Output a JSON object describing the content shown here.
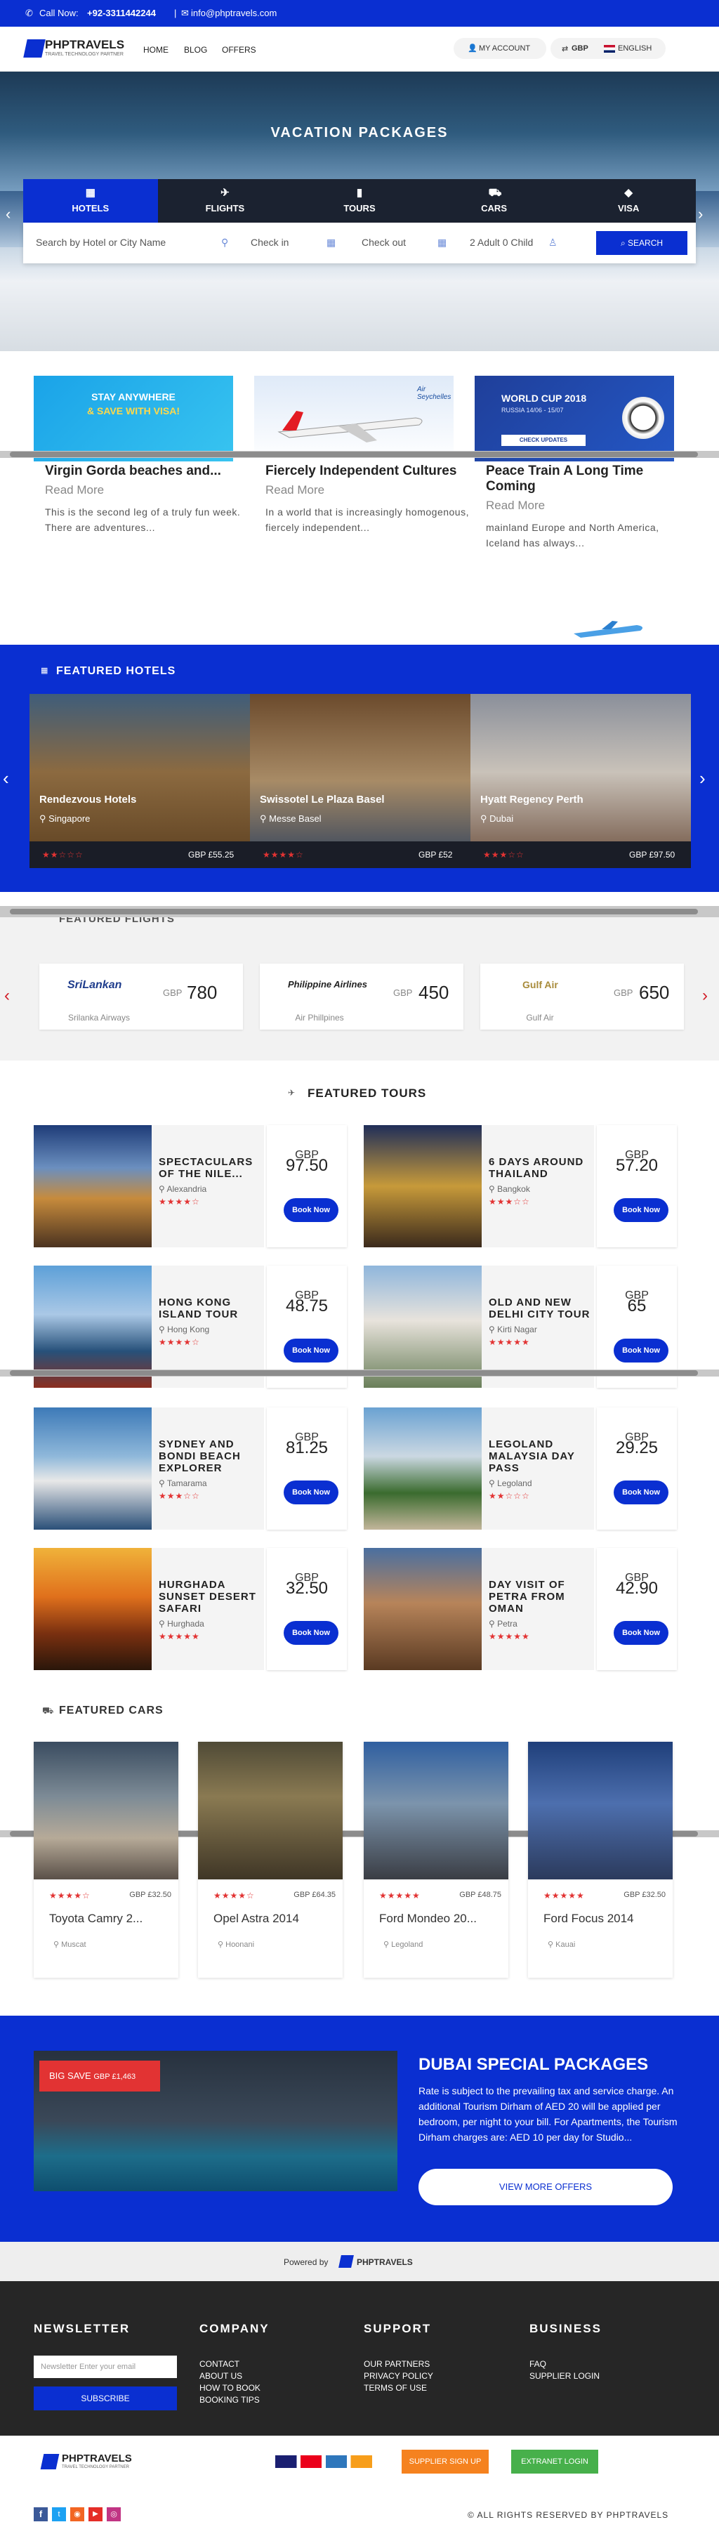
{
  "topbar": {
    "phone_label": "Call Now:",
    "phone": "+92-3311442244",
    "email": "info@phptravels.com"
  },
  "brand": {
    "name": "PHPTRAVELS",
    "tagline": "TRAVEL TECHNOLOGY PARTNER"
  },
  "nav": {
    "items": [
      "HOME",
      "BLOG",
      "OFFERS"
    ],
    "account": "MY ACCOUNT",
    "currency": "GBP",
    "language": "ENGLISH"
  },
  "hero": {
    "title": "VACATION PACKAGES",
    "tabs": [
      {
        "label": "HOTELS",
        "icon": "building-icon"
      },
      {
        "label": "FLIGHTS",
        "icon": "plane-icon"
      },
      {
        "label": "TOURS",
        "icon": "briefcase-icon"
      },
      {
        "label": "CARS",
        "icon": "car-icon"
      },
      {
        "label": "VISA",
        "icon": "tag-icon"
      }
    ],
    "search": {
      "placeholder": "Search by Hotel or City Name",
      "checkin": "Check in",
      "checkout": "Check out",
      "guests": "2 Adult 0 Child",
      "button": "SEARCH"
    }
  },
  "banners": [
    {
      "line1": "STAY ANYWHERE",
      "line2": "& SAVE WITH VISA!"
    },
    {
      "brand": "Air Seychelles"
    },
    {
      "title": "WORLD CUP 2018",
      "sub": "RUSSIA 14/06 - 15/07",
      "cta": "CHECK UPDATES"
    }
  ],
  "posts": [
    {
      "title": "Virgin Gorda beaches and...",
      "more": "Read More",
      "excerpt": "This is the second leg of a truly fun week. There are adventures..."
    },
    {
      "title": "Fiercely Independent Cultures",
      "more": "Read More",
      "excerpt": "In a world that is increasingly homogenous, fiercely independent..."
    },
    {
      "title": "Peace Train A Long Time Coming",
      "more": "Read More",
      "excerpt": " mainland Europe and North America, Iceland has always..."
    }
  ],
  "featured_hotels": {
    "title": "FEATURED HOTELS",
    "items": [
      {
        "name": "Rendezvous Hotels",
        "location": "Singapore",
        "stars": 2,
        "price": "GBP £55.25"
      },
      {
        "name": "Swissotel Le Plaza Basel",
        "location": "Messe Basel",
        "stars": 4,
        "price": "GBP £52"
      },
      {
        "name": "Hyatt Regency Perth",
        "location": "Dubai",
        "stars": 3,
        "price": "GBP £97.50"
      }
    ]
  },
  "featured_flights": {
    "title": "FEATURED FLIGHTS",
    "items": [
      {
        "airline": "Srilanka Airways",
        "logo": "SriLankan",
        "currency": "GBP",
        "price": "780"
      },
      {
        "airline": "Air Phillpines",
        "logo": "Philippine Airlines",
        "currency": "GBP",
        "price": "450"
      },
      {
        "airline": "Gulf Air",
        "logo": "Gulf Air",
        "currency": "GBP",
        "price": "650"
      }
    ]
  },
  "featured_tours": {
    "title": "FEATURED TOURS",
    "book": "Book Now",
    "items": [
      {
        "title": "SPECTACULARS OF THE NILE...",
        "location": "Alexandria",
        "stars": 4,
        "currency": "GBP",
        "price": "97.50"
      },
      {
        "title": "6 DAYS AROUND THAILAND",
        "location": "Bangkok",
        "stars": 3,
        "currency": "GBP",
        "price": "57.20"
      },
      {
        "title": "HONG KONG ISLAND TOUR",
        "location": "Hong Kong",
        "stars": 4,
        "currency": "GBP",
        "price": "48.75"
      },
      {
        "title": "OLD AND NEW DELHI CITY TOUR",
        "location": "Kirti Nagar",
        "stars": 5,
        "currency": "GBP",
        "price": "65"
      },
      {
        "title": "SYDNEY AND BONDI BEACH EXPLORER",
        "location": "Tamarama",
        "stars": 3,
        "currency": "GBP",
        "price": "81.25"
      },
      {
        "title": "LEGOLAND MALAYSIA DAY PASS",
        "location": "Legoland",
        "stars": 2,
        "currency": "GBP",
        "price": "29.25"
      },
      {
        "title": "HURGHADA SUNSET DESERT SAFARI",
        "location": "Hurghada",
        "stars": 5,
        "currency": "GBP",
        "price": "32.50"
      },
      {
        "title": "DAY VISIT OF PETRA FROM OMAN",
        "location": "Petra",
        "stars": 5,
        "currency": "GBP",
        "price": "42.90"
      }
    ]
  },
  "featured_cars": {
    "title": "FEATURED CARS",
    "items": [
      {
        "name": "Toyota Camry 2...",
        "location": "Muscat",
        "stars": 4,
        "price": "GBP £32.50"
      },
      {
        "name": "Opel Astra 2014",
        "location": "Hoonani",
        "stars": 4,
        "price": "GBP £64.35"
      },
      {
        "name": "Ford Mondeo 20...",
        "location": "Legoland",
        "stars": 5,
        "price": "GBP £48.75"
      },
      {
        "name": "Ford Focus 2014",
        "location": "Kauai",
        "stars": 5,
        "price": "GBP £32.50"
      }
    ]
  },
  "dubai": {
    "badge": "BIG SAVE",
    "badge_price": "GBP £1,463",
    "title": "DUBAI SPECIAL PACKAGES",
    "text": "Rate is subject to the prevailing tax and service charge. An additional Tourism Dirham of AED 20 will be applied per bedroom, per night to your bill. For Apartments, the Tourism Dirham charges are: AED 10 per day for Studio...",
    "button": "VIEW MORE OFFERS"
  },
  "powered": {
    "label": "Powered by",
    "brand": "PHPTRAVELS"
  },
  "footer": {
    "newsletter": {
      "title": "NEWSLETTER",
      "placeholder": "Newsletter Enter your email",
      "button": "SUBSCRIBE"
    },
    "company": {
      "title": "COMPANY",
      "links": [
        "CONTACT",
        "ABOUT US",
        "HOW TO BOOK",
        "BOOKING TIPS"
      ]
    },
    "support": {
      "title": "SUPPORT",
      "links": [
        "OUR PARTNERS",
        "PRIVACY POLICY",
        "TERMS OF USE"
      ]
    },
    "business": {
      "title": "BUSINESS",
      "links": [
        "FAQ",
        "SUPPLIER LOGIN"
      ]
    },
    "supplier_btn": "SUPPLIER SIGN UP",
    "extranet_btn": "EXTRANET LOGIN",
    "copyright": "© ALL RIGHTS RESERVED BY PHPTRAVELS"
  }
}
